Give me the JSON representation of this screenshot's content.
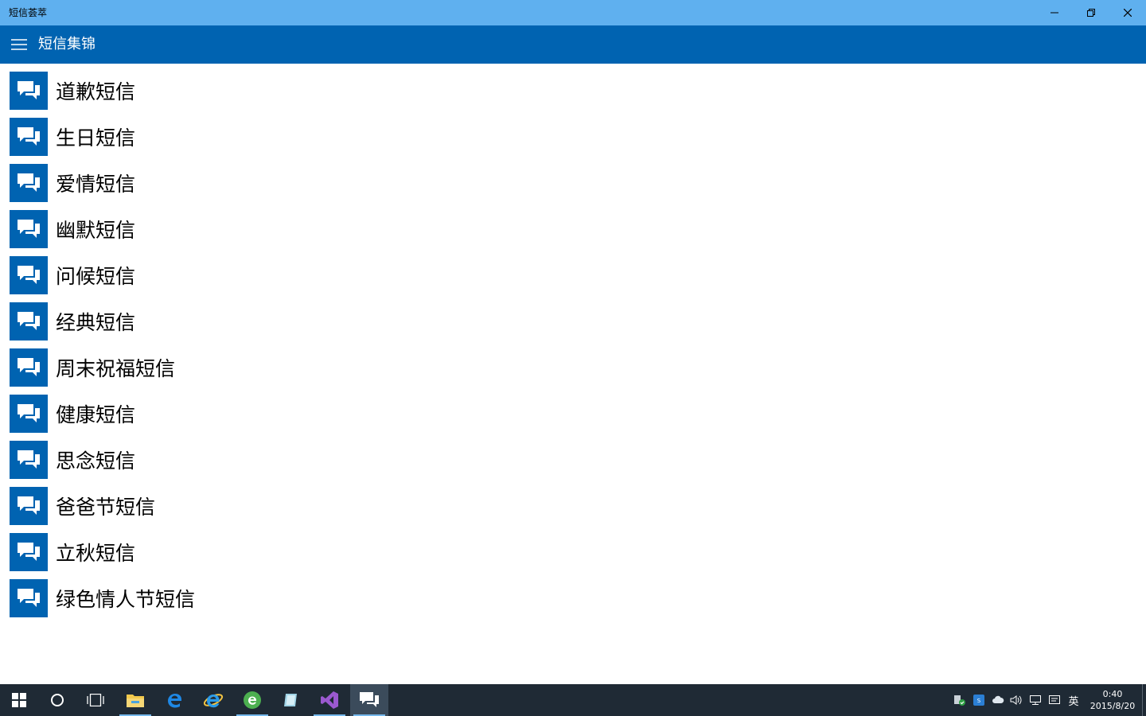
{
  "window": {
    "title": "短信荟萃"
  },
  "appbar": {
    "title": "短信集锦"
  },
  "categories": [
    {
      "label": "道歉短信"
    },
    {
      "label": "生日短信"
    },
    {
      "label": "爱情短信"
    },
    {
      "label": "幽默短信"
    },
    {
      "label": "问候短信"
    },
    {
      "label": "经典短信"
    },
    {
      "label": "周末祝福短信"
    },
    {
      "label": "健康短信"
    },
    {
      "label": "思念短信"
    },
    {
      "label": "爸爸节短信"
    },
    {
      "label": "立秋短信"
    },
    {
      "label": "绿色情人节短信"
    }
  ],
  "taskbar": {
    "clock": {
      "time": "0:40",
      "date": "2015/8/20"
    },
    "ime": "英"
  },
  "colors": {
    "titlebar": "#5fb0ef",
    "accent": "#0063b1",
    "taskbar": "#1f2a35"
  }
}
